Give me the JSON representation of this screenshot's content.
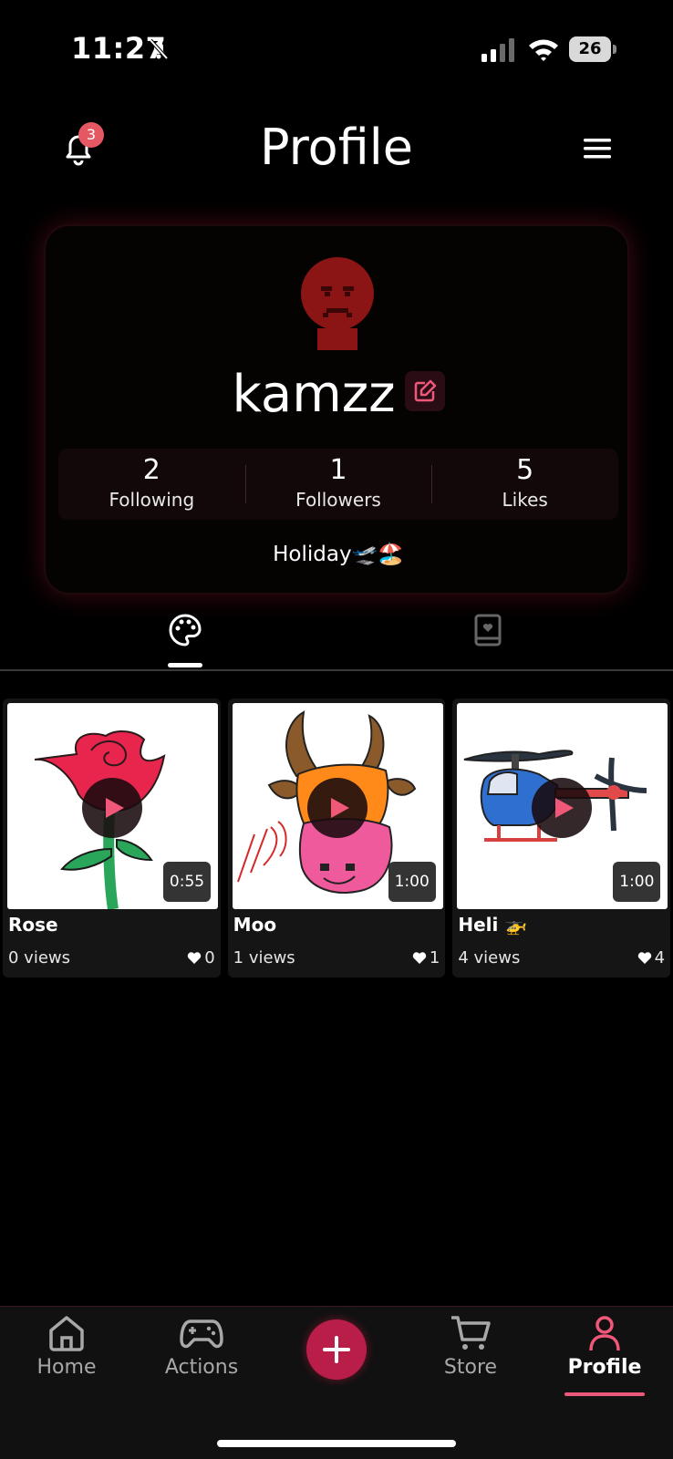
{
  "status_bar": {
    "time": "11:27",
    "battery": "26"
  },
  "header": {
    "title": "Profile",
    "notification_count": "3"
  },
  "profile": {
    "username": "kamzz",
    "stats": [
      {
        "value": "2",
        "label": "Following"
      },
      {
        "value": "1",
        "label": "Followers"
      },
      {
        "value": "5",
        "label": "Likes"
      }
    ],
    "bio": "Holiday🛫🏖️"
  },
  "tabs": [
    {
      "icon": "palette-icon",
      "active": true
    },
    {
      "icon": "saved-book-icon",
      "active": false
    }
  ],
  "drawings": [
    {
      "title": "Rose",
      "duration": "0:55",
      "views": "0 views",
      "likes": "0"
    },
    {
      "title": "Moo",
      "duration": "1:00",
      "views": "1 views",
      "likes": "1"
    },
    {
      "title": "Heli 🚁",
      "duration": "1:00",
      "views": "4 views",
      "likes": "4"
    }
  ],
  "nav": {
    "home": "Home",
    "actions": "Actions",
    "store": "Store",
    "profile": "Profile"
  },
  "colors": {
    "accent": "#f0587a",
    "create_button": "#b81e48",
    "avatar": "#8b1414"
  }
}
